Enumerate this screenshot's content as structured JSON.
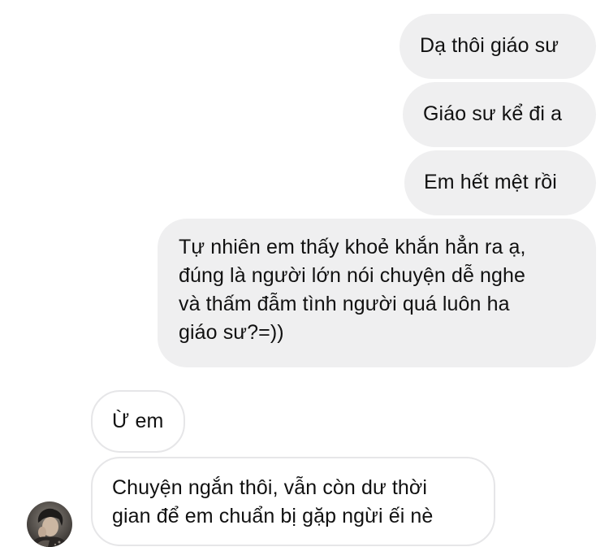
{
  "chat": {
    "messages": [
      {
        "sender": "me",
        "text": "Dạ thôi giáo sư"
      },
      {
        "sender": "me",
        "text": "Giáo sư kể đi a"
      },
      {
        "sender": "me",
        "text": "Em hết mệt rồi"
      },
      {
        "sender": "me",
        "lines": [
          "Tự nhiên em thấy khoẻ khắn hẳn ra ạ,",
          "đúng là người lớn nói chuyện dễ nghe",
          "và thấm đẫm tình người quá luôn ha",
          "giáo sư?=))"
        ]
      },
      {
        "sender": "other",
        "text": "Ừ em"
      },
      {
        "sender": "other",
        "lines": [
          "Chuyện ngắn thôi, vẫn còn dư thời",
          "gian để em chuẩn bị gặp ngừi ếi nè"
        ]
      }
    ]
  },
  "colors": {
    "sent_bubble": "#efeff0",
    "received_border": "#e6e6e8",
    "text": "#111111"
  },
  "icons": {
    "avatar": "profile-photo"
  }
}
